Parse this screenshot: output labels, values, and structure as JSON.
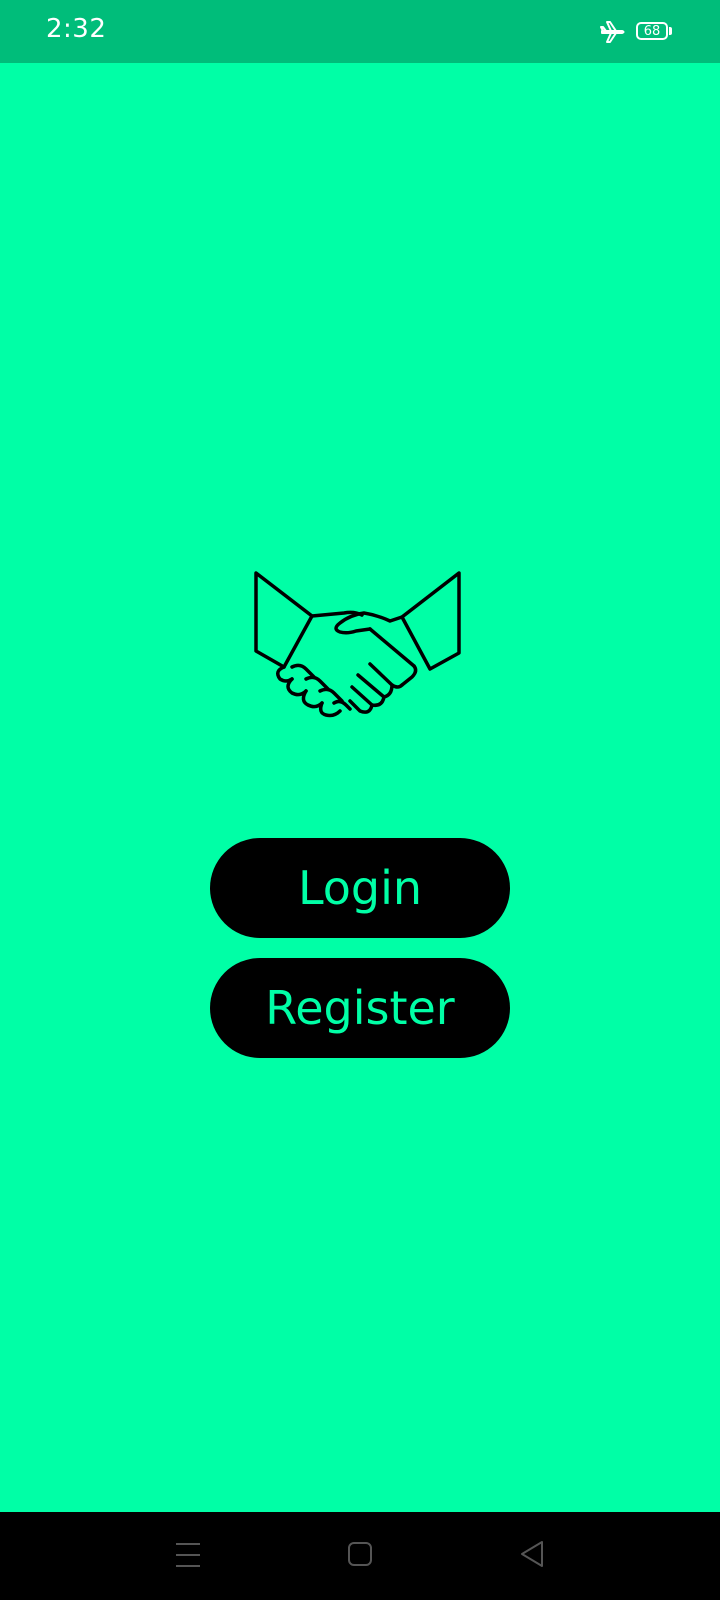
{
  "status_bar": {
    "time": "2:32",
    "battery_level": "68",
    "icons": [
      "airplane-icon",
      "battery-icon"
    ]
  },
  "main": {
    "logo_icon": "handshake-icon",
    "login_label": "Login",
    "register_label": "Register"
  },
  "nav_bar": {
    "icons": [
      "menu-icon",
      "home-icon",
      "back-icon"
    ]
  },
  "colors": {
    "background": "#00FFA6",
    "status_bar": "#00BD7A",
    "button": "#000000",
    "button_text": "#00FFA6",
    "nav_bar": "#000000"
  }
}
